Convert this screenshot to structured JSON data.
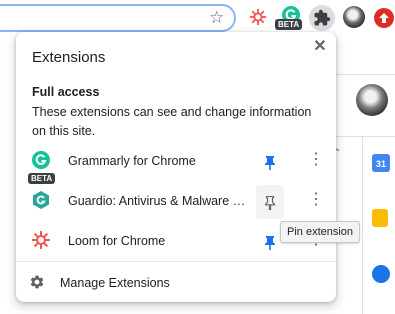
{
  "toolbar": {
    "beta_label": "BETA",
    "icons": [
      "star-icon",
      "loom-icon",
      "grammarly-icon",
      "extensions-puzzle-icon",
      "profile-avatar",
      "update-icon"
    ]
  },
  "popup": {
    "title": "Extensions",
    "close_glyph": "✕",
    "section_title": "Full access",
    "section_description": "These extensions can see and change information on this site.",
    "extensions": [
      {
        "name": "Grammarly for Chrome",
        "badge": "BETA",
        "pinned": true,
        "color": "#15c39a"
      },
      {
        "name": "Guardio: Antivirus & Malware Protection",
        "pinned": false,
        "color": "#26a69a"
      },
      {
        "name": "Loom for Chrome",
        "pinned": true,
        "color": "#f2544f"
      }
    ],
    "more_glyph": "⋮",
    "manage_label": "Manage Extensions"
  },
  "tooltip": {
    "text": "Pin extension"
  },
  "side_panel": {
    "calendar_label": "31"
  },
  "colors": {
    "accent": "#1a73e8",
    "pin_active": "#1a73e8",
    "pin_inactive": "#5f6368"
  }
}
